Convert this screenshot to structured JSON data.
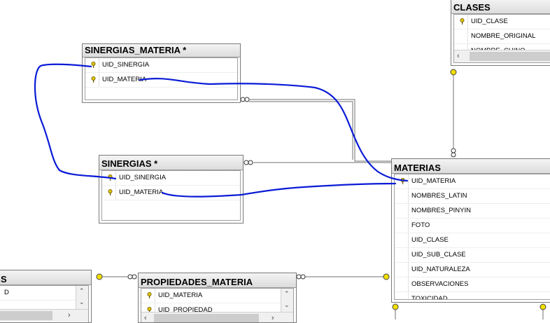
{
  "diagram": {
    "tables": {
      "clases": {
        "title": "CLASES",
        "columns": [
          "UID_CLASE",
          "NOMBRE_ORIGINAL",
          "NOMBRE_CHINO"
        ]
      },
      "sinergias_materia": {
        "title": "SINERGIAS_MATERIA *",
        "columns": [
          "UID_SINERGIA",
          "UID_MATERIA"
        ]
      },
      "sinergias": {
        "title": "SINERGIAS *",
        "columns": [
          "UID_SINERGIA",
          "UID_MATERIA"
        ]
      },
      "materias": {
        "title": "MATERIAS",
        "columns": [
          "UID_MATERIA",
          "NOMBRES_LATIN",
          "NOMBRES_PINYIN",
          "FOTO",
          "UID_CLASE",
          "UID_SUB_CLASE",
          "UID_NATURALEZA",
          "OBSERVACIONES",
          "TOXICIDAD"
        ]
      },
      "propiedades_materia": {
        "title": "PROPIEDADES_MATERIA",
        "columns": [
          "UID_MATERIA",
          "UID_PROPIEDAD"
        ]
      },
      "partial_left": {
        "title": "S",
        "columns": [
          "D"
        ]
      }
    },
    "colors": {
      "annotation": "#0a1bd6",
      "key_icon": "#e0c400",
      "line": "#707070",
      "key_end": "#f2de00"
    }
  }
}
